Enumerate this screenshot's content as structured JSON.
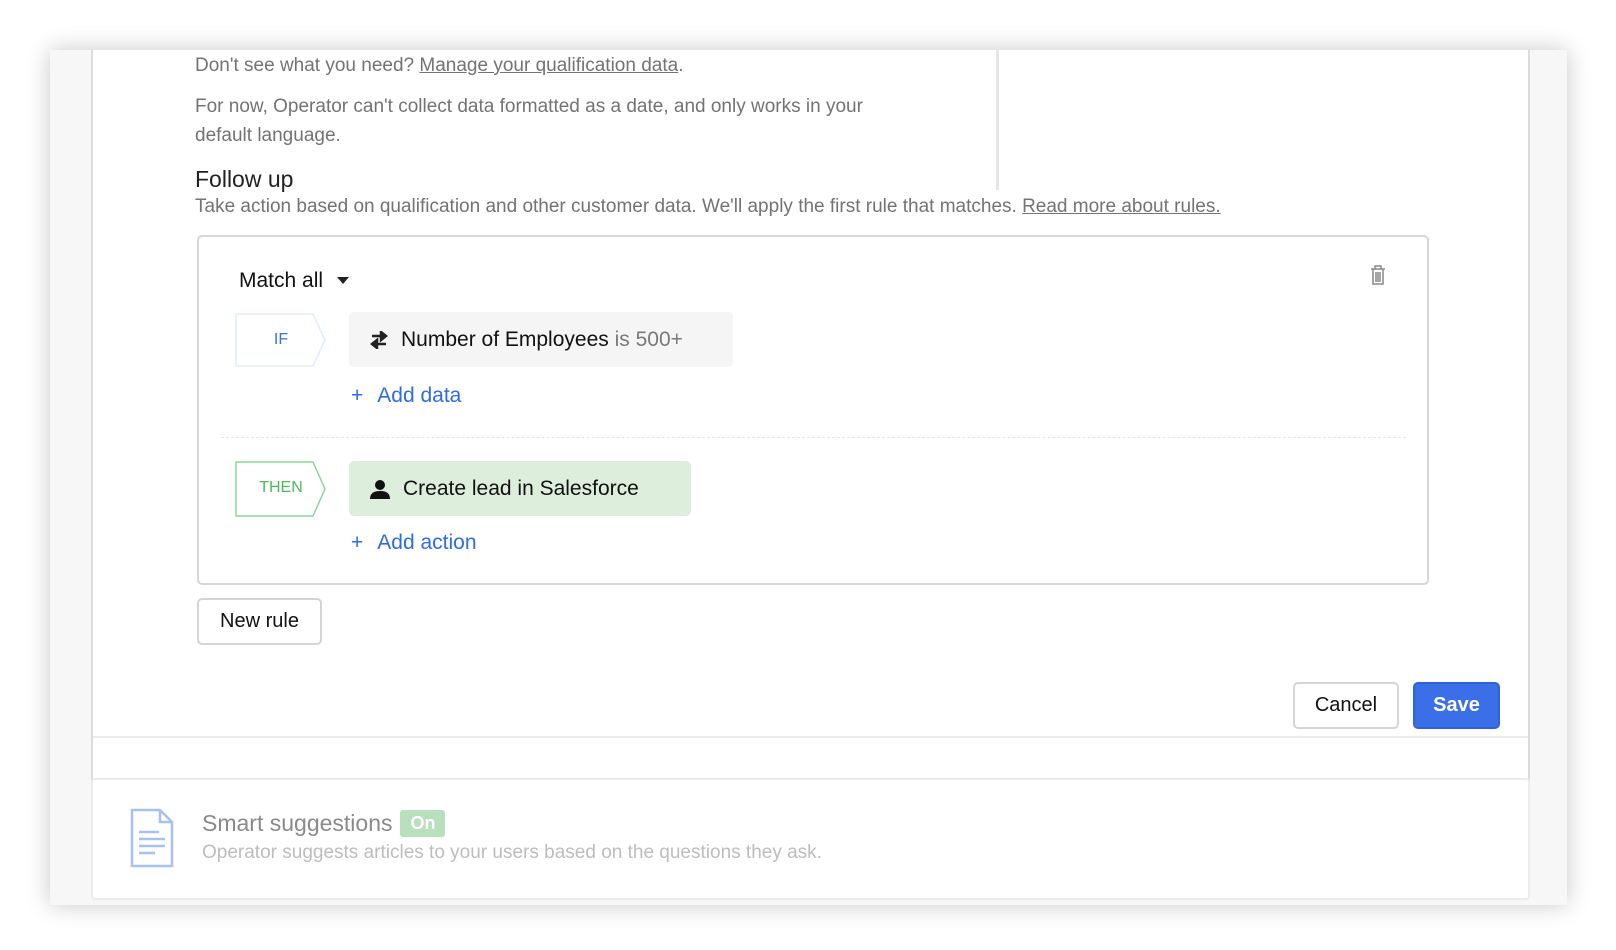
{
  "qualification": {
    "prompt": "Don't see what you need?",
    "manage_link": "Manage your qualification data",
    "note": "For now, Operator can't collect data formatted as a date, and only works in your default language."
  },
  "follow_up": {
    "title": "Follow up",
    "description": "Take action based on qualification and other customer data. We'll apply the first rule that matches.",
    "read_more_link": "Read more about rules."
  },
  "rule": {
    "match_mode": "Match all",
    "if_label": "IF",
    "condition": {
      "icon": "swap-arrows-icon",
      "attribute": "Number of Employees",
      "operator_value": "is 500+"
    },
    "add_data": "Add data",
    "then_label": "THEN",
    "action": {
      "icon": "person-icon",
      "label": "Create lead in Salesforce"
    },
    "add_action": "Add action"
  },
  "new_rule": "New rule",
  "footer": {
    "cancel": "Cancel",
    "save": "Save"
  },
  "smart_suggestions": {
    "title": "Smart suggestions",
    "status": "On",
    "description": "Operator suggests articles to your users based on the questions they ask."
  },
  "colors": {
    "accent": "#3a6fe8",
    "then_green": "#5cc56a",
    "action_bg": "#deeedd",
    "condition_bg": "#f5f5f5"
  }
}
